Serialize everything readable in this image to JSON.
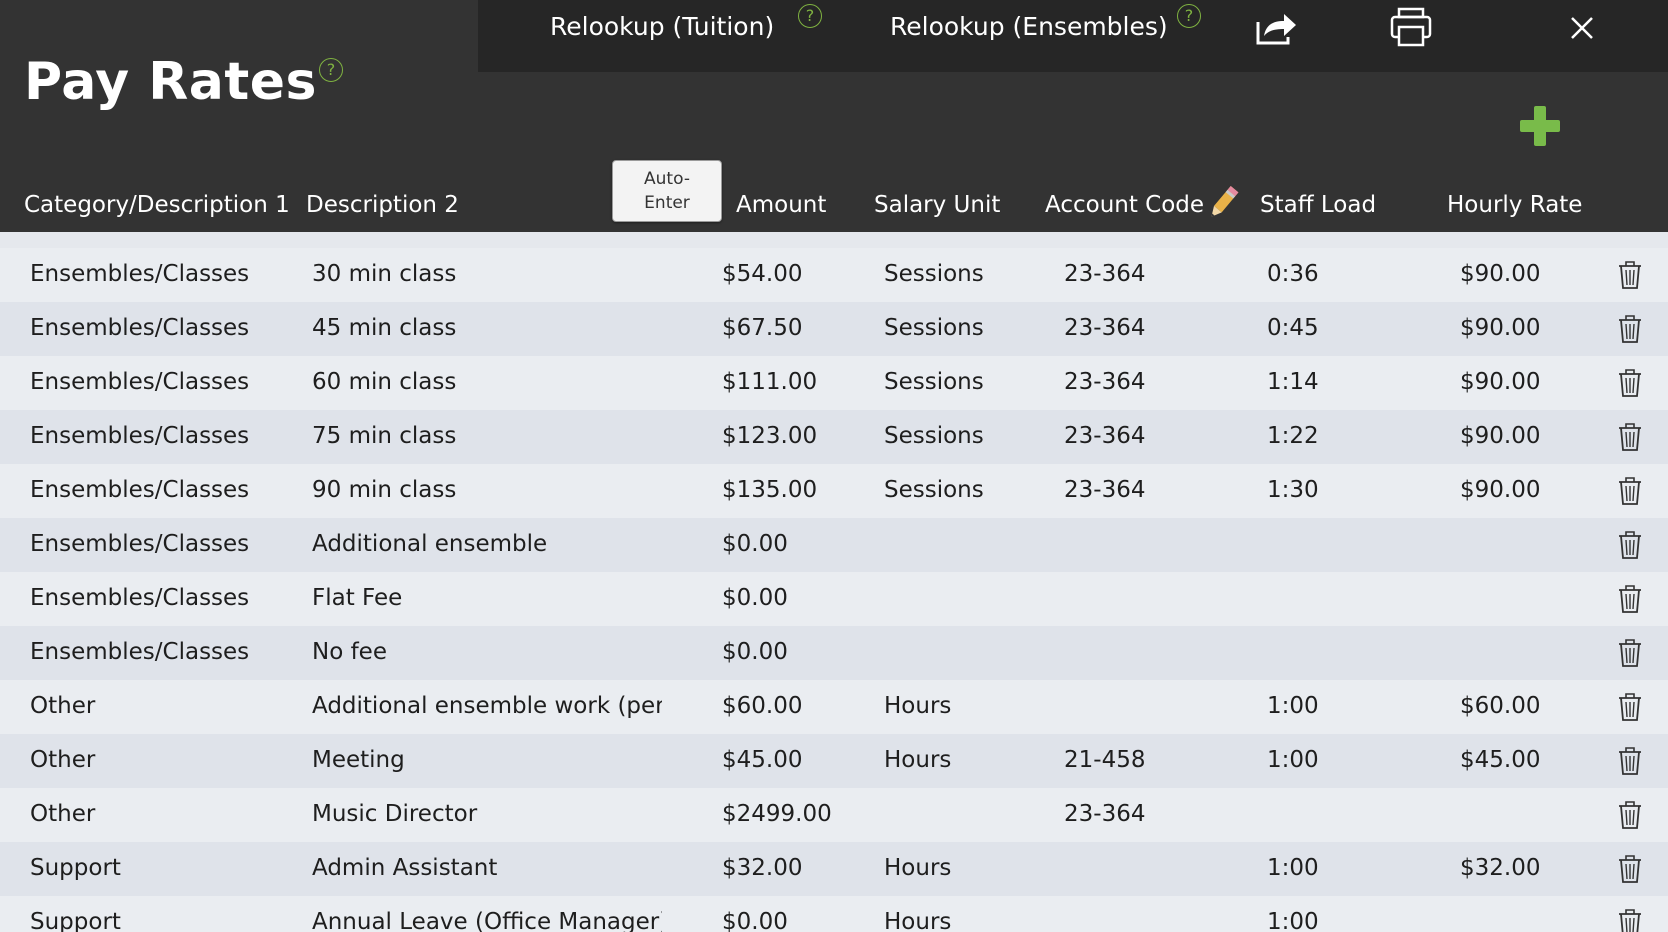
{
  "topbar": {
    "relookup_tuition_label": "Relookup (Tuition)",
    "relookup_ensembles_label": "Relookup (Ensembles)",
    "help_glyph": "?",
    "icons": [
      "export-icon",
      "print-icon",
      "close-icon",
      "help-icon",
      "add-icon",
      "pencil-icon",
      "trash-icon"
    ]
  },
  "page": {
    "title": "Pay Rates",
    "auto_enter_line1": "Auto-",
    "auto_enter_line2": "Enter"
  },
  "columns": {
    "category": "Category/Description 1",
    "description": "Description 2",
    "amount": "Amount",
    "salary_unit": "Salary Unit",
    "account_code": "Account Code",
    "staff_load": "Staff Load",
    "hourly_rate": "Hourly Rate"
  },
  "colors": {
    "header_bg": "#333333",
    "topbar_bg": "#262626",
    "accent_green": "#79bb4a",
    "row_light": "#eaedf1",
    "row_dark": "#dfe3ea"
  },
  "rows": [
    {
      "category": "Ensembles/Classes",
      "description": "30 min class",
      "amount": "$54.00",
      "unit": "Sessions",
      "account": "23-364",
      "load": "0:36",
      "rate": "$90.00"
    },
    {
      "category": "Ensembles/Classes",
      "description": "45 min class",
      "amount": "$67.50",
      "unit": "Sessions",
      "account": "23-364",
      "load": "0:45",
      "rate": "$90.00"
    },
    {
      "category": "Ensembles/Classes",
      "description": "60 min class",
      "amount": "$111.00",
      "unit": "Sessions",
      "account": "23-364",
      "load": "1:14",
      "rate": "$90.00"
    },
    {
      "category": "Ensembles/Classes",
      "description": "75 min class",
      "amount": "$123.00",
      "unit": "Sessions",
      "account": "23-364",
      "load": "1:22",
      "rate": "$90.00"
    },
    {
      "category": "Ensembles/Classes",
      "description": "90 min class",
      "amount": "$135.00",
      "unit": "Sessions",
      "account": "23-364",
      "load": "1:30",
      "rate": "$90.00"
    },
    {
      "category": "Ensembles/Classes",
      "description": "Additional ensemble",
      "amount": "$0.00",
      "unit": "",
      "account": "",
      "load": "",
      "rate": ""
    },
    {
      "category": "Ensembles/Classes",
      "description": "Flat Fee",
      "amount": "$0.00",
      "unit": "",
      "account": "",
      "load": "",
      "rate": ""
    },
    {
      "category": "Ensembles/Classes",
      "description": "No fee",
      "amount": "$0.00",
      "unit": "",
      "account": "",
      "load": "",
      "rate": ""
    },
    {
      "category": "Other",
      "description": "Additional ensemble work (per",
      "amount": "$60.00",
      "unit": "Hours",
      "account": "",
      "load": "1:00",
      "rate": "$60.00"
    },
    {
      "category": "Other",
      "description": "Meeting",
      "amount": "$45.00",
      "unit": "Hours",
      "account": "21-458",
      "load": "1:00",
      "rate": "$45.00"
    },
    {
      "category": "Other",
      "description": "Music Director",
      "amount": "$2499.00",
      "unit": "",
      "account": "23-364",
      "load": "",
      "rate": ""
    },
    {
      "category": "Support",
      "description": "Admin Assistant",
      "amount": "$32.00",
      "unit": "Hours",
      "account": "",
      "load": "1:00",
      "rate": "$32.00"
    },
    {
      "category": "Support",
      "description": "Annual Leave (Office Manager)",
      "amount": "$0.00",
      "unit": "Hours",
      "account": "",
      "load": "1:00",
      "rate": ""
    }
  ]
}
